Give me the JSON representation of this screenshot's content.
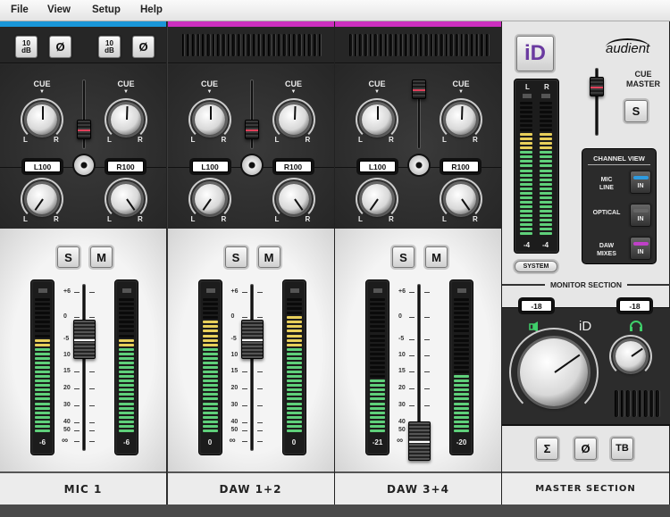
{
  "menu": [
    "File",
    "View",
    "Setup",
    "Help"
  ],
  "colors": {
    "mic_channel": "#1a96d8",
    "daw_channel": "#cc2fbf",
    "meter_green": "#5fd07a",
    "meter_yellow": "#e8cf5a",
    "headphone_green": "#3fcf6a"
  },
  "labels": {
    "cue": "CUE",
    "left": "L",
    "right": "R",
    "solo": "S",
    "mute": "M",
    "pad": "10 dB",
    "phase": "Ø"
  },
  "fader_scale": [
    "+6",
    "0",
    "-5",
    "10",
    "15",
    "20",
    "30",
    "40",
    "50",
    "∞"
  ],
  "channels": [
    {
      "name": "MIC 1",
      "type": "mic",
      "pan_left": "L100",
      "pan_right": "R100",
      "meter_left": "-6",
      "meter_right": "-6",
      "level_left_db": -6,
      "level_right_db": -6,
      "fader_db": -5,
      "cue_fader": 0.2,
      "has_input_buttons": true
    },
    {
      "name": "DAW 1+2",
      "type": "daw",
      "pan_left": "L100",
      "pan_right": "R100",
      "meter_left": "0",
      "meter_right": "0",
      "level_left_db": 0,
      "level_right_db": 2,
      "fader_db": -5,
      "cue_fader": 0.2,
      "has_input_buttons": false
    },
    {
      "name": "DAW 3+4",
      "type": "daw",
      "pan_left": "L100",
      "pan_right": "R100",
      "meter_left": "-21",
      "meter_right": "-20",
      "level_left_db": -21,
      "level_right_db": -20,
      "fader_db": "-inf",
      "cue_fader": 1.0,
      "has_input_buttons": false
    }
  ],
  "master": {
    "logo": "audient",
    "id_button": "iD",
    "meter_labels": [
      "L",
      "R"
    ],
    "meter_values": [
      "-4",
      "-4"
    ],
    "meter_levels_db": [
      -4,
      -4
    ],
    "system_button": "SYSTEM",
    "cue_master_line1": "CUE",
    "cue_master_line2": "MASTER",
    "cue_master_solo": "S",
    "channel_view": {
      "title": "CHANNEL VIEW",
      "items": [
        {
          "label1": "MIC",
          "label2": "LINE",
          "button": "IN",
          "led": "#2e9be0"
        },
        {
          "label1": "OPTICAL",
          "label2": "",
          "button": "IN",
          "led": "#666666"
        },
        {
          "label1": "DAW",
          "label2": "MIXES",
          "button": "IN",
          "led": "#c040c8"
        }
      ]
    },
    "monitor_section_title": "MONITOR SECTION",
    "speaker_level": "-18",
    "headphone_level": "-18",
    "monitor_logo": "iD",
    "buttons": [
      "Σ",
      "Ø",
      "TB"
    ],
    "name": "MASTER SECTION"
  }
}
